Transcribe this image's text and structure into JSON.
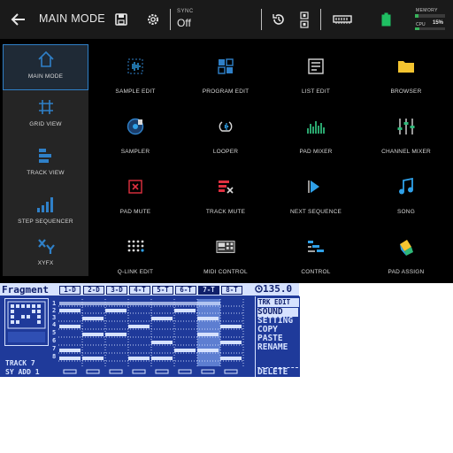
{
  "topbar": {
    "title": "MAIN MODE",
    "sync_label": "SYNC",
    "sync_value": "Off",
    "memory_label": "MEMORY",
    "cpu_label": "CPU",
    "cpu_value": "15%",
    "memory_level": 0.12,
    "cpu_level": 0.15,
    "colors": {
      "accent": "#2f80c8",
      "battery": "#1fbf62",
      "meter": "#38b25a"
    }
  },
  "sidebar": {
    "items": [
      {
        "label": "MAIN MODE",
        "icon": "home-icon",
        "active": true
      },
      {
        "label": "GRID VIEW",
        "icon": "grid-view-icon"
      },
      {
        "label": "TRACK VIEW",
        "icon": "track-view-icon"
      },
      {
        "label": "STEP SEQUENCER",
        "icon": "step-sequencer-icon"
      },
      {
        "label": "XYFX",
        "icon": "xyfx-icon"
      }
    ]
  },
  "tiles": [
    {
      "label": "SAMPLE EDIT",
      "icon": "sample-edit-icon"
    },
    {
      "label": "PROGRAM EDIT",
      "icon": "program-edit-icon"
    },
    {
      "label": "LIST EDIT",
      "icon": "list-edit-icon"
    },
    {
      "label": "BROWSER",
      "icon": "folder-icon"
    },
    {
      "label": "SAMPLER",
      "icon": "sampler-icon"
    },
    {
      "label": "LOOPER",
      "icon": "looper-icon"
    },
    {
      "label": "PAD MIXER",
      "icon": "pad-mixer-icon"
    },
    {
      "label": "CHANNEL MIXER",
      "icon": "channel-mixer-icon"
    },
    {
      "label": "PAD MUTE",
      "icon": "pad-mute-icon"
    },
    {
      "label": "TRACK MUTE",
      "icon": "track-mute-icon"
    },
    {
      "label": "NEXT SEQUENCE",
      "icon": "next-sequence-icon"
    },
    {
      "label": "SONG",
      "icon": "music-note-icon"
    },
    {
      "label": "Q-LINK EDIT",
      "icon": "q-link-edit-icon"
    },
    {
      "label": "MIDI CONTROL",
      "icon": "midi-control-icon"
    },
    {
      "label": "CONTROL",
      "icon": "control-icon"
    },
    {
      "label": "PAD ASSIGN",
      "icon": "pad-assign-icon"
    }
  ],
  "lcd": {
    "title": "Fragment",
    "tracks": [
      "1-D",
      "2-D",
      "3-D",
      "4-T",
      "5-T",
      "6-T",
      "7-T",
      "8-T"
    ],
    "selected_track": 6,
    "tempo": "135.0",
    "row_numbers": [
      "1",
      "2",
      "3",
      "4",
      "5",
      "6",
      "7",
      "8"
    ],
    "track_label": "TRACK 7",
    "sy_label": "SY ADD 1",
    "menu": {
      "header": "TRK EDIT",
      "items": [
        "SOUND",
        "SETTING",
        "COPY",
        "PASTE",
        "RENAME"
      ],
      "highlighted": 0,
      "delete": "DELETE"
    }
  }
}
